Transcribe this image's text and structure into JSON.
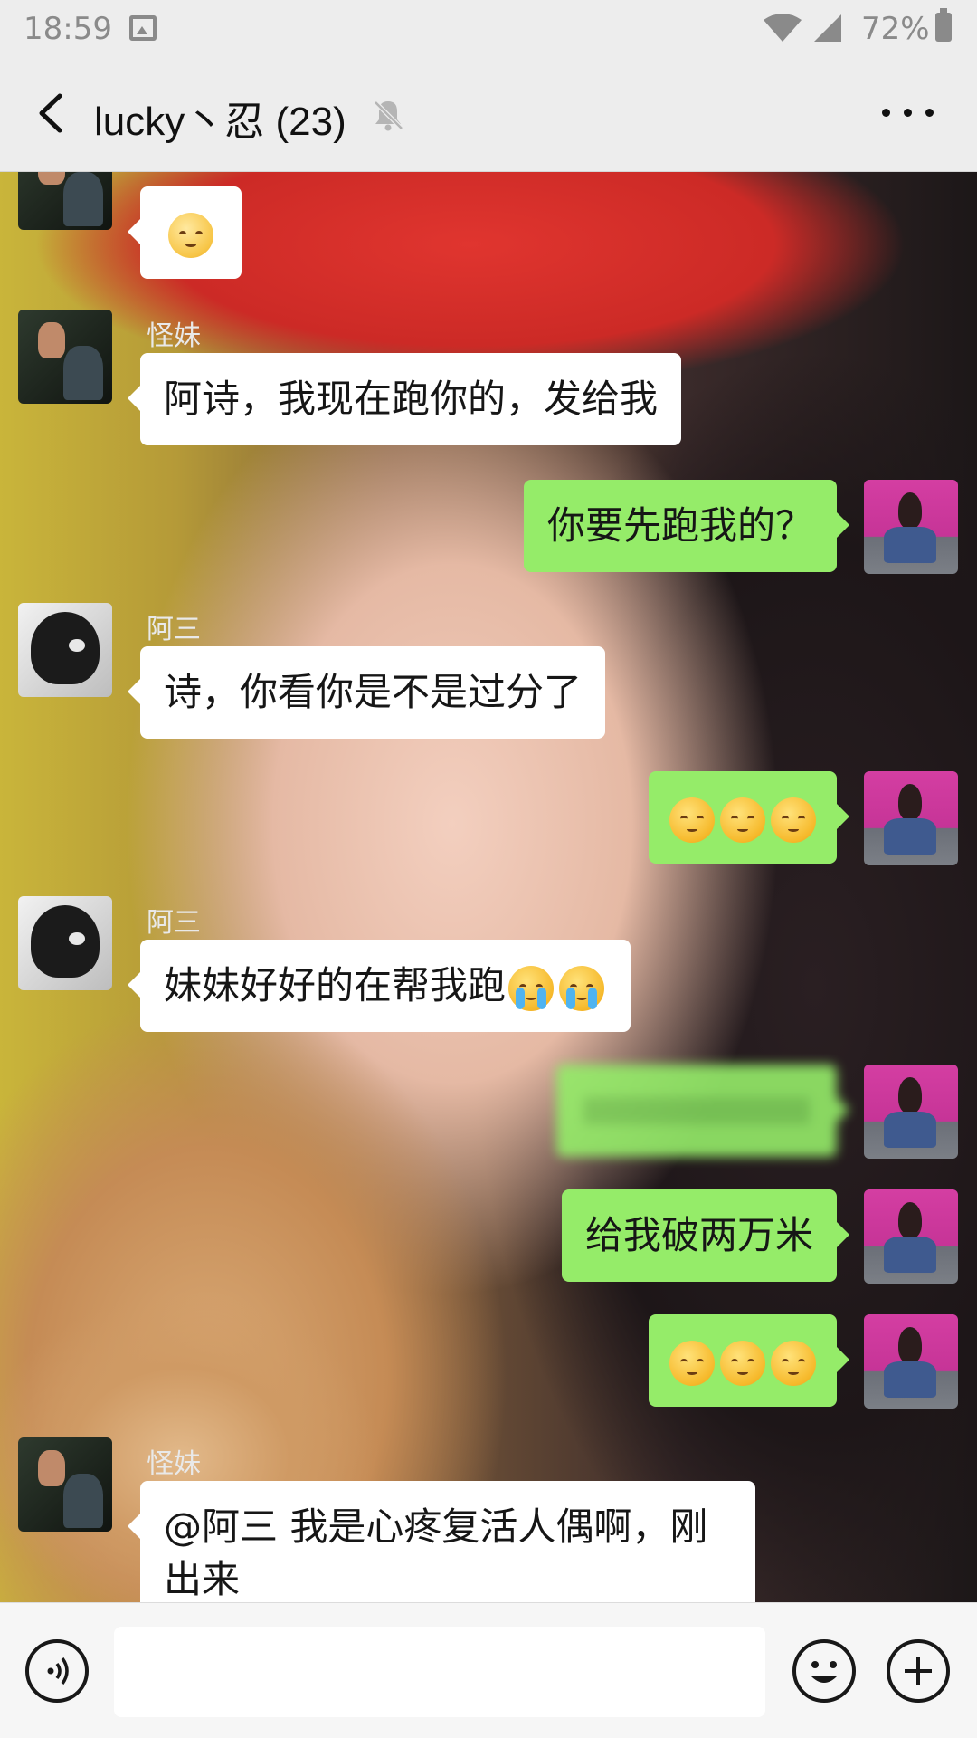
{
  "status_bar": {
    "time": "18:59",
    "battery": "72%"
  },
  "nav": {
    "title": "lucky丶忍 (23)"
  },
  "messages": [
    {
      "side": "in",
      "sender": "怪妹",
      "text": "",
      "emoji": [
        "pleading"
      ]
    },
    {
      "side": "in",
      "sender": "怪妹",
      "text": "阿诗，我现在跑你的，发给我"
    },
    {
      "side": "out",
      "text": "你要先跑我的？"
    },
    {
      "side": "in",
      "sender": "阿三",
      "text": "诗，你看你是不是过分了"
    },
    {
      "side": "out",
      "text": "",
      "emoji": [
        "smile",
        "smile",
        "smile"
      ]
    },
    {
      "side": "in",
      "sender": "阿三",
      "text": "妹妹好好的在帮我跑",
      "emoji": [
        "cry",
        "cry"
      ]
    },
    {
      "side": "out",
      "text": "",
      "blurred": true
    },
    {
      "side": "out",
      "text": "给我破两万米"
    },
    {
      "side": "out",
      "text": "",
      "emoji": [
        "smile",
        "smile",
        "smile"
      ]
    },
    {
      "side": "in",
      "sender": "怪妹",
      "text": "@阿三 我是心疼复活人偶啊，刚出来"
    }
  ],
  "input": {
    "value": "",
    "placeholder": ""
  },
  "colors": {
    "bubble_out": "#95ec69",
    "bubble_in": "#ffffff",
    "nav_bg": "#ededed"
  },
  "icons": [
    "back-icon",
    "mute-icon",
    "more-icon",
    "voice-icon",
    "emoji-icon",
    "plus-icon"
  ]
}
